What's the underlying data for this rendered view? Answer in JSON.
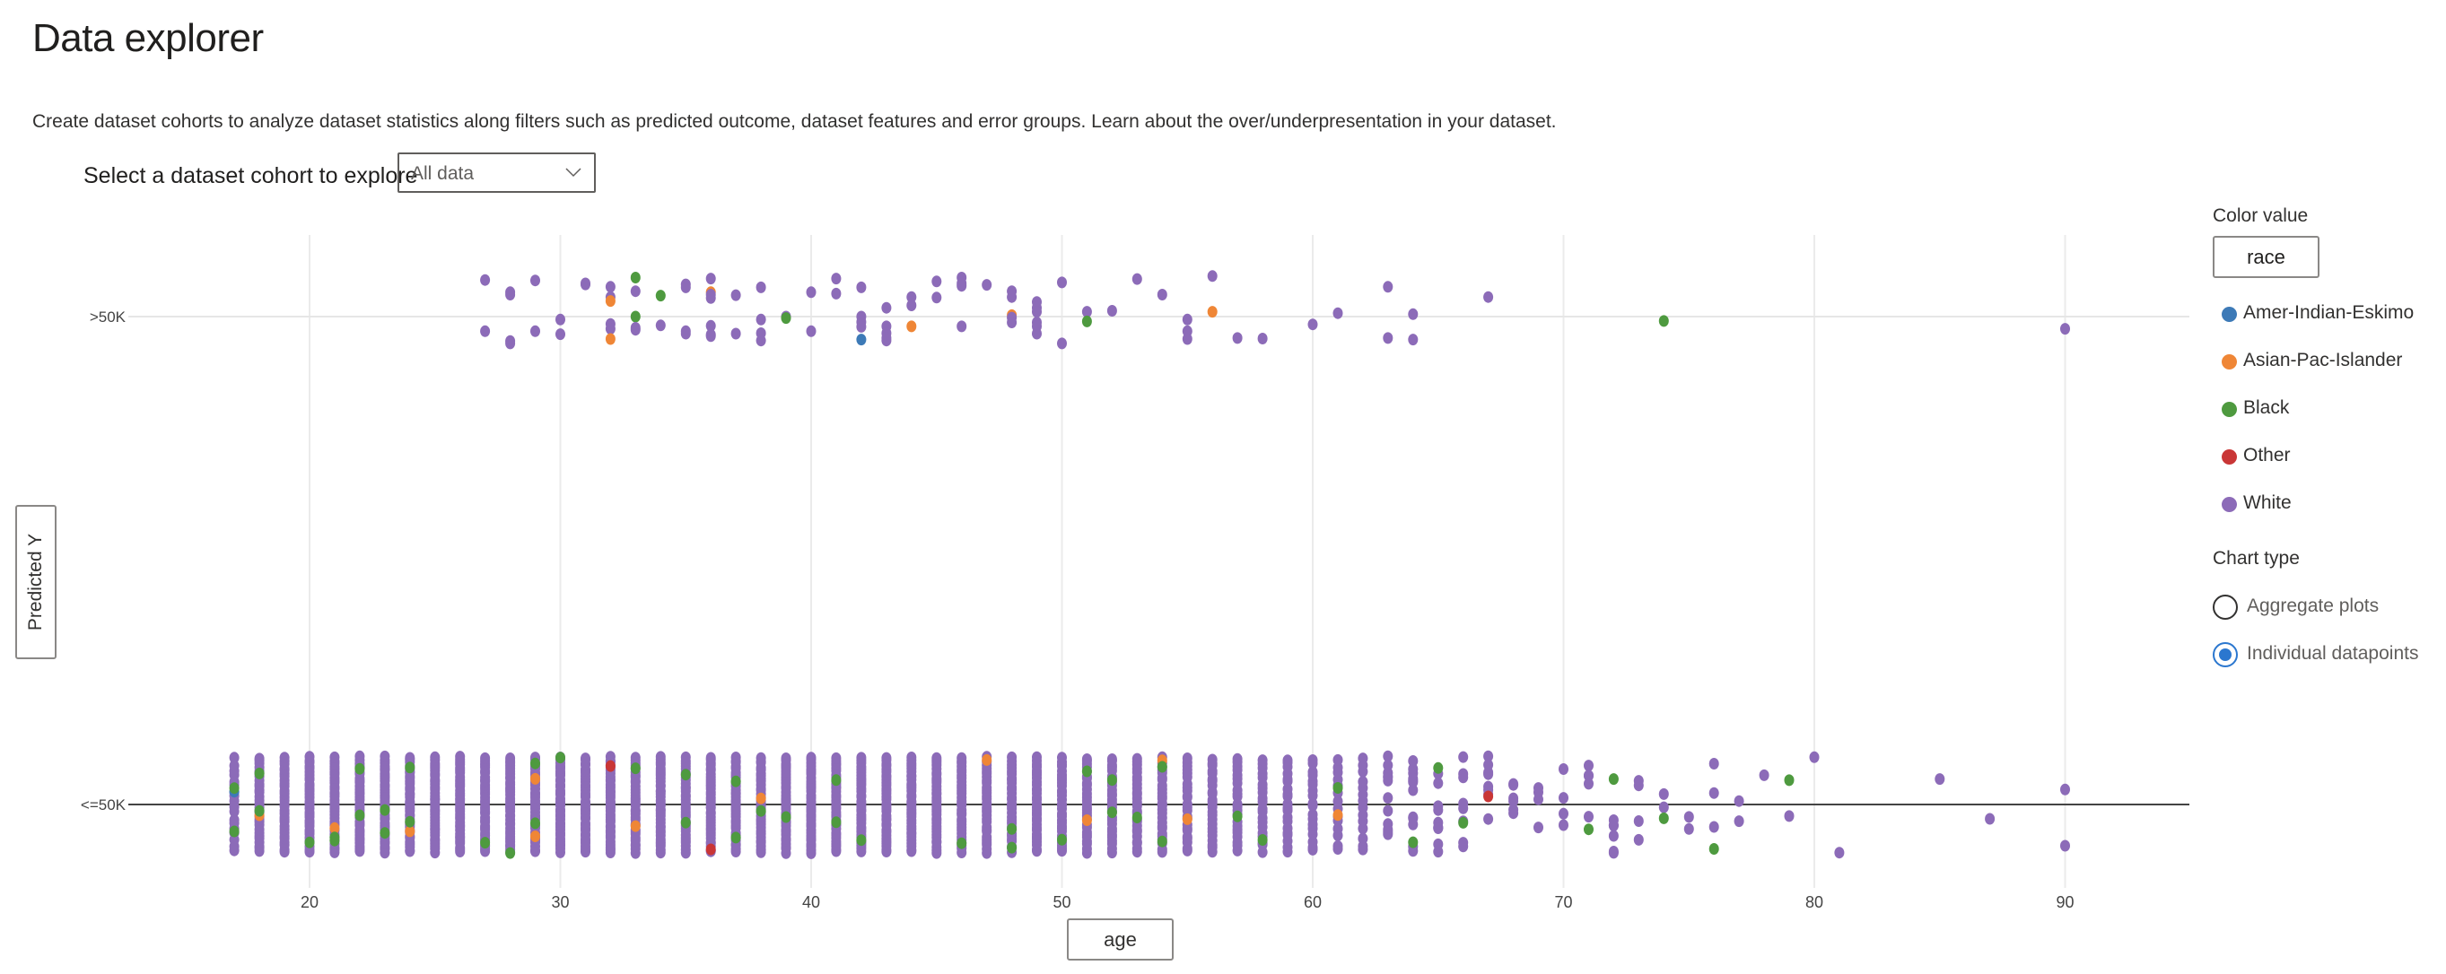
{
  "page": {
    "title": "Data explorer",
    "description": "Create dataset cohorts to analyze dataset statistics along filters such as predicted outcome, dataset features and error groups. Learn about the over/underpresentation in your dataset.",
    "cohort_label": "Select a dataset cohort to explore",
    "cohort_dropdown": {
      "selected": "All data",
      "icon": "chevron-down-icon"
    }
  },
  "side_panel": {
    "color_value_label": "Color value",
    "color_value_button": "race",
    "legend": [
      {
        "label": "Amer-Indian-Eskimo",
        "color": "#3d7ab7"
      },
      {
        "label": "Asian-Pac-Islander",
        "color": "#ef8636"
      },
      {
        "label": "Black",
        "color": "#4e9a3f"
      },
      {
        "label": "Other",
        "color": "#c93636"
      },
      {
        "label": "White",
        "color": "#8c6bb8"
      }
    ],
    "chart_type_label": "Chart type",
    "chart_type_options": [
      {
        "label": "Aggregate plots",
        "checked": false
      },
      {
        "label": "Individual datapoints",
        "checked": true
      }
    ]
  },
  "axes": {
    "x_button": "age",
    "y_button": "Predicted Y"
  },
  "chart_data": {
    "type": "scatter",
    "title": "",
    "xlabel": "age",
    "ylabel": "Predicted Y",
    "xlim": [
      15,
      95
    ],
    "x_ticks": [
      20,
      30,
      40,
      50,
      60,
      70,
      80,
      90
    ],
    "y_categories": [
      "<=50K",
      ">50K"
    ],
    "grid": true,
    "legend": "right",
    "color_by": "race",
    "series_colors": {
      "Amer-Indian-Eskimo": "#3d7ab7",
      "Asian-Pac-Islander": "#ef8636",
      "Black": "#4e9a3f",
      "Other": "#c93636",
      "White": "#8c6bb8"
    },
    "points_gt50k": [
      [
        27,
        0.075,
        "W"
      ],
      [
        27,
        -0.03,
        "W"
      ],
      [
        28,
        0.05,
        "W"
      ],
      [
        28,
        0.045,
        "W"
      ],
      [
        28,
        -0.05,
        "W"
      ],
      [
        28,
        -0.055,
        "W"
      ],
      [
        29,
        0.074,
        "W"
      ],
      [
        29,
        -0.03,
        "W"
      ],
      [
        30,
        -0.006,
        "W"
      ],
      [
        30,
        -0.036,
        "W"
      ],
      [
        31,
        0.068,
        "W"
      ],
      [
        31,
        0.066,
        "W"
      ],
      [
        32,
        0.061,
        "W"
      ],
      [
        32,
        0.04,
        "W"
      ],
      [
        32,
        0.032,
        "A"
      ],
      [
        32,
        -0.015,
        "W"
      ],
      [
        32,
        -0.025,
        "W"
      ],
      [
        32,
        -0.046,
        "A"
      ],
      [
        33,
        0.08,
        "B"
      ],
      [
        33,
        0.052,
        "W"
      ],
      [
        33,
        0.0,
        "B"
      ],
      [
        33,
        -0.023,
        "W"
      ],
      [
        33,
        -0.027,
        "W"
      ],
      [
        34,
        0.043,
        "B"
      ],
      [
        34,
        -0.018,
        "W"
      ],
      [
        35,
        0.066,
        "W"
      ],
      [
        35,
        0.06,
        "W"
      ],
      [
        35,
        -0.035,
        "W"
      ],
      [
        35,
        -0.03,
        "W"
      ],
      [
        36,
        0.078,
        "W"
      ],
      [
        36,
        0.05,
        "A"
      ],
      [
        36,
        0.045,
        "W"
      ],
      [
        36,
        0.038,
        "W"
      ],
      [
        36,
        -0.019,
        "W"
      ],
      [
        36,
        -0.037,
        "W"
      ],
      [
        36,
        -0.04,
        "W"
      ],
      [
        37,
        0.044,
        "W"
      ],
      [
        37,
        -0.035,
        "W"
      ],
      [
        38,
        0.06,
        "W"
      ],
      [
        38,
        -0.006,
        "W"
      ],
      [
        38,
        -0.034,
        "W"
      ],
      [
        38,
        -0.049,
        "W"
      ],
      [
        39,
        0.0,
        "W"
      ],
      [
        39,
        -0.003,
        "B"
      ],
      [
        40,
        0.05,
        "W"
      ],
      [
        40,
        -0.03,
        "W"
      ],
      [
        41,
        0.078,
        "W"
      ],
      [
        41,
        0.047,
        "W"
      ],
      [
        42,
        0.06,
        "W"
      ],
      [
        42,
        0.0,
        "W"
      ],
      [
        42,
        -0.011,
        "W"
      ],
      [
        42,
        -0.021,
        "W"
      ],
      [
        42,
        -0.047,
        "I"
      ],
      [
        43,
        0.018,
        "W"
      ],
      [
        43,
        -0.02,
        "W"
      ],
      [
        43,
        -0.034,
        "W"
      ],
      [
        43,
        -0.044,
        "W"
      ],
      [
        43,
        -0.049,
        "W"
      ],
      [
        44,
        0.04,
        "W"
      ],
      [
        44,
        0.023,
        "W"
      ],
      [
        44,
        -0.02,
        "A"
      ],
      [
        45,
        0.072,
        "W"
      ],
      [
        45,
        0.039,
        "W"
      ],
      [
        46,
        0.08,
        "W"
      ],
      [
        46,
        0.068,
        "W"
      ],
      [
        46,
        0.063,
        "W"
      ],
      [
        46,
        -0.02,
        "W"
      ],
      [
        47,
        0.065,
        "W"
      ],
      [
        48,
        0.052,
        "W"
      ],
      [
        48,
        0.04,
        "W"
      ],
      [
        48,
        0.003,
        "A"
      ],
      [
        48,
        -0.002,
        "W"
      ],
      [
        48,
        -0.012,
        "W"
      ],
      [
        49,
        0.03,
        "W"
      ],
      [
        49,
        0.018,
        "W"
      ],
      [
        49,
        0.01,
        "W"
      ],
      [
        49,
        -0.012,
        "W"
      ],
      [
        49,
        -0.02,
        "W"
      ],
      [
        49,
        -0.035,
        "W"
      ],
      [
        50,
        0.07,
        "W"
      ],
      [
        50,
        -0.055,
        "W"
      ],
      [
        51,
        0.01,
        "W"
      ],
      [
        51,
        -0.01,
        "B"
      ],
      [
        52,
        0.012,
        "W"
      ],
      [
        53,
        0.077,
        "W"
      ],
      [
        54,
        0.045,
        "W"
      ],
      [
        55,
        -0.006,
        "W"
      ],
      [
        55,
        -0.03,
        "W"
      ],
      [
        55,
        -0.046,
        "W"
      ],
      [
        56,
        0.083,
        "W"
      ],
      [
        56,
        0.01,
        "A"
      ],
      [
        57,
        -0.044,
        "W"
      ],
      [
        58,
        -0.045,
        "W"
      ],
      [
        60,
        -0.016,
        "W"
      ],
      [
        61,
        0.007,
        "W"
      ],
      [
        63,
        0.061,
        "W"
      ],
      [
        63,
        -0.044,
        "W"
      ],
      [
        64,
        0.005,
        "W"
      ],
      [
        64,
        -0.047,
        "W"
      ],
      [
        67,
        0.04,
        "W"
      ],
      [
        74,
        -0.009,
        "B"
      ],
      [
        90,
        -0.025,
        "W"
      ]
    ],
    "counts_le50k_by_age": {
      "17": {
        "W": 18,
        "B": 2,
        "I": 1
      },
      "18": {
        "W": 30,
        "A": 1,
        "B": 2
      },
      "19": {
        "W": 30
      },
      "20": {
        "W": 34,
        "B": 1
      },
      "21": {
        "W": 34,
        "A": 1,
        "B": 2
      },
      "22": {
        "W": 34,
        "B": 2
      },
      "23": {
        "W": 36,
        "B": 2
      },
      "24": {
        "W": 36,
        "A": 1,
        "B": 2
      },
      "25": {
        "W": 36
      },
      "26": {
        "W": 36
      },
      "27": {
        "W": 36,
        "B": 1
      },
      "28": {
        "W": 36,
        "B": 1
      },
      "29": {
        "W": 34,
        "A": 2,
        "B": 2
      },
      "30": {
        "W": 36,
        "B": 1
      },
      "31": {
        "W": 36
      },
      "32": {
        "W": 36,
        "O": 1
      },
      "33": {
        "W": 34,
        "A": 1,
        "B": 1
      },
      "34": {
        "W": 36
      },
      "35": {
        "W": 34,
        "B": 2
      },
      "36": {
        "W": 36,
        "O": 1
      },
      "37": {
        "W": 34,
        "B": 2
      },
      "38": {
        "W": 32,
        "A": 1,
        "B": 1
      },
      "39": {
        "W": 34,
        "B": 1
      },
      "40": {
        "W": 34
      },
      "41": {
        "W": 34,
        "B": 2
      },
      "42": {
        "W": 34,
        "B": 1
      },
      "43": {
        "W": 34
      },
      "44": {
        "W": 34
      },
      "45": {
        "W": 34
      },
      "46": {
        "W": 32,
        "B": 1
      },
      "47": {
        "W": 30,
        "A": 1
      },
      "48": {
        "W": 30,
        "B": 2
      },
      "49": {
        "W": 32
      },
      "50": {
        "W": 30,
        "B": 1
      },
      "51": {
        "W": 28,
        "A": 1,
        "B": 1
      },
      "52": {
        "W": 28,
        "B": 2
      },
      "53": {
        "W": 26,
        "B": 1
      },
      "54": {
        "W": 26,
        "A": 1,
        "B": 2
      },
      "55": {
        "W": 24,
        "A": 1
      },
      "56": {
        "W": 24
      },
      "57": {
        "W": 22,
        "B": 1
      },
      "58": {
        "W": 20,
        "B": 1
      },
      "59": {
        "W": 20
      },
      "60": {
        "W": 18
      },
      "61": {
        "W": 14,
        "A": 1,
        "B": 1
      },
      "62": {
        "W": 14
      },
      "63": {
        "W": 12
      },
      "64": {
        "W": 12,
        "B": 1
      },
      "65": {
        "W": 10,
        "B": 1
      },
      "66": {
        "W": 8,
        "B": 1
      },
      "67": {
        "W": 8,
        "O": 1
      },
      "68": {
        "W": 6
      },
      "69": {
        "W": 4
      },
      "70": {
        "W": 4
      },
      "71": {
        "W": 5,
        "B": 1
      },
      "72": {
        "W": 6,
        "B": 1
      },
      "73": {
        "W": 4
      },
      "74": {
        "W": 2,
        "B": 1
      },
      "75": {
        "W": 2
      },
      "76": {
        "W": 3,
        "B": 1
      },
      "77": {
        "W": 2
      },
      "78": {
        "W": 1
      },
      "79": {
        "W": 1,
        "B": 1
      },
      "80": {
        "W": 1
      },
      "81": {
        "W": 1
      },
      "85": {
        "W": 1
      },
      "87": {
        "W": 1
      },
      "90": {
        "W": 2
      }
    },
    "race_codes": {
      "I": "Amer-Indian-Eskimo",
      "A": "Asian-Pac-Islander",
      "B": "Black",
      "O": "Other",
      "W": "White"
    }
  }
}
